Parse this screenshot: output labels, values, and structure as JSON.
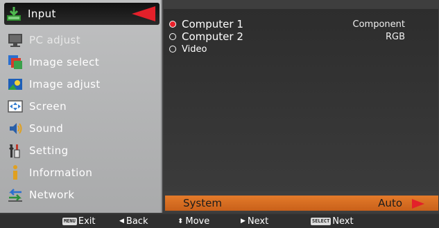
{
  "menu": {
    "items": [
      {
        "label": "Input",
        "icon": "input-icon",
        "selected": true
      },
      {
        "label": "PC adjust",
        "icon": "pc-adjust-icon"
      },
      {
        "label": "Image select",
        "icon": "image-select-icon"
      },
      {
        "label": "Image adjust",
        "icon": "image-adjust-icon"
      },
      {
        "label": "Screen",
        "icon": "screen-icon"
      },
      {
        "label": "Sound",
        "icon": "sound-icon"
      },
      {
        "label": "Setting",
        "icon": "setting-icon"
      },
      {
        "label": "Information",
        "icon": "information-icon"
      },
      {
        "label": "Network",
        "icon": "network-icon"
      }
    ]
  },
  "inputs": [
    {
      "name": "Computer 1",
      "value": "Component",
      "selected": true
    },
    {
      "name": "Computer 2",
      "value": "RGB",
      "selected": false
    },
    {
      "name": "Video",
      "value": "",
      "selected": false
    }
  ],
  "system": {
    "label": "System",
    "value": "Auto"
  },
  "help": {
    "exit_chip": "MENU",
    "exit": "Exit",
    "back": "Back",
    "move": "Move",
    "next": "Next",
    "select_chip": "SELECT",
    "select_next": "Next"
  },
  "colors": {
    "selection_arrow": "#e3202a",
    "system_bar": "#e47b2a",
    "radio_selected": "#e8202a"
  }
}
